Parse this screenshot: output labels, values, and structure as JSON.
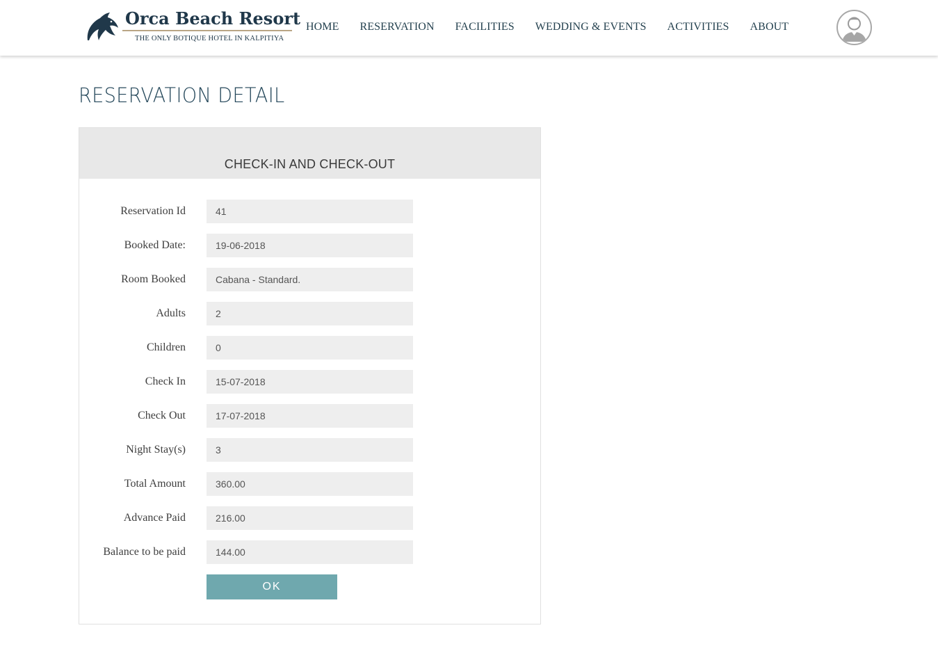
{
  "brand": {
    "name": "Orca Beach Resort",
    "tagline": "THE ONLY BOTIQUE HOTEL IN KALPITIYA",
    "logo_icon": "dolphin-icon"
  },
  "nav": {
    "items": [
      {
        "label": "HOME"
      },
      {
        "label": "RESERVATION"
      },
      {
        "label": "FACILITIES"
      },
      {
        "label": "WEDDING & EVENTS"
      },
      {
        "label": "ACTIVITIES"
      },
      {
        "label": "ABOUT"
      }
    ]
  },
  "user": {
    "avatar_icon": "user-avatar-icon"
  },
  "page": {
    "title": "RESERVATION DETAIL"
  },
  "card": {
    "heading": "CHECK-IN AND CHECK-OUT",
    "fields": [
      {
        "label": "Reservation Id",
        "value": "41"
      },
      {
        "label": "Booked Date:",
        "value": "19-06-2018"
      },
      {
        "label": "Room Booked",
        "value": "Cabana - Standard."
      },
      {
        "label": "Adults",
        "value": "2"
      },
      {
        "label": "Children",
        "value": "0"
      },
      {
        "label": "Check In",
        "value": "15-07-2018"
      },
      {
        "label": "Check Out",
        "value": "17-07-2018"
      },
      {
        "label": "Night Stay(s)",
        "value": "3"
      },
      {
        "label": "Total Amount",
        "value": "360.00"
      },
      {
        "label": "Advance Paid",
        "value": "216.00"
      },
      {
        "label": "Balance to be paid",
        "value": "144.00"
      }
    ],
    "ok_label": "OK"
  },
  "colors": {
    "brand_navy": "#20384a",
    "button_teal": "#6fa8ae",
    "field_bg": "#eeeeee",
    "card_header_bg": "#e8e8e8"
  }
}
